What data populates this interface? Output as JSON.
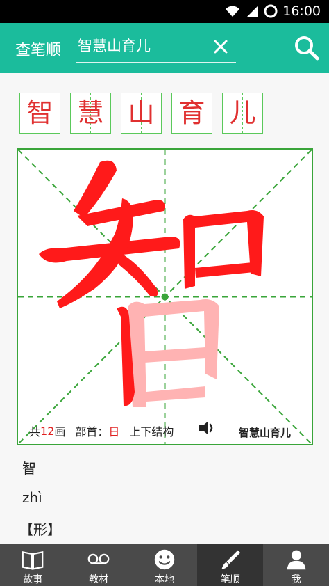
{
  "status_bar": {
    "time": "16:00"
  },
  "app_bar": {
    "title": "查笔顺",
    "search_value": "智慧山育儿"
  },
  "characters": [
    "智",
    "慧",
    "山",
    "育",
    "儿"
  ],
  "current": {
    "character": "智",
    "stroke_prefix": "共",
    "stroke_count": "12",
    "stroke_suffix": "画",
    "radical_label": "部首：",
    "radical": "日",
    "structure": "上下结构",
    "watermark": "智慧山育儿",
    "pinyin": "zhì",
    "section": "【形】"
  },
  "tabs": [
    {
      "label": "故事",
      "icon": "book-icon"
    },
    {
      "label": "教材",
      "icon": "tape-icon"
    },
    {
      "label": "本地",
      "icon": "smiley-icon"
    },
    {
      "label": "笔顺",
      "icon": "brush-icon"
    },
    {
      "label": "我",
      "icon": "person-icon"
    }
  ],
  "colors": {
    "accent": "#1bbc9c",
    "grid": "#3aa53a",
    "stroke_done": "#ff1a1a",
    "stroke_pending": "#ffb3b3",
    "tab_bg": "#4a4a4a",
    "tab_active": "#333333"
  }
}
